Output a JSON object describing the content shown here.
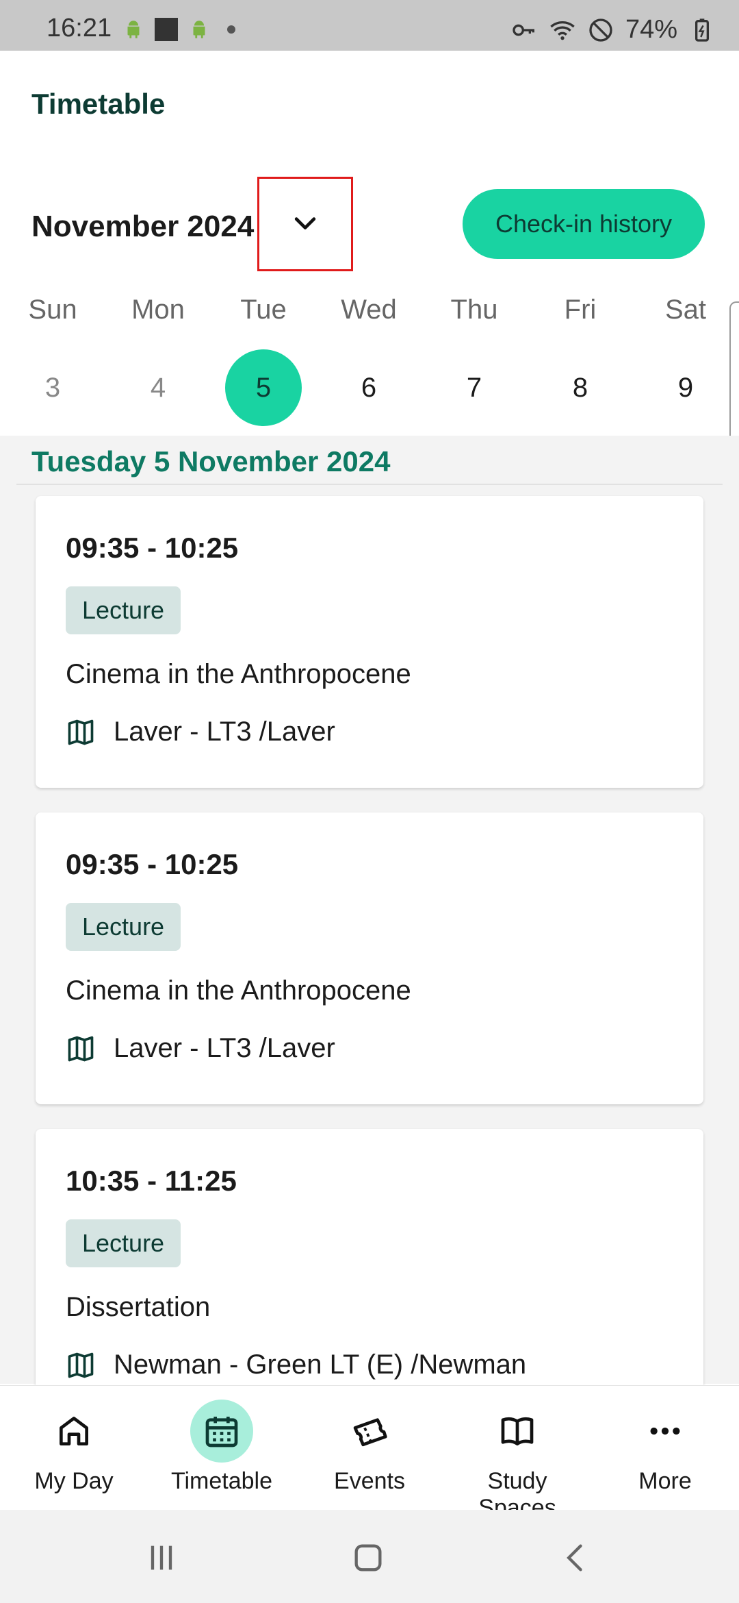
{
  "status_bar": {
    "time": "16:21",
    "battery": "74%"
  },
  "header": {
    "title": "Timetable",
    "month": "November 2024",
    "checkin_label": "Check-in history"
  },
  "week": {
    "days": [
      {
        "name": "Sun",
        "num": "3"
      },
      {
        "name": "Mon",
        "num": "4"
      },
      {
        "name": "Tue",
        "num": "5"
      },
      {
        "name": "Wed",
        "num": "6"
      },
      {
        "name": "Thu",
        "num": "7"
      },
      {
        "name": "Fri",
        "num": "8"
      },
      {
        "name": "Sat",
        "num": "9"
      }
    ],
    "selected": "5"
  },
  "agenda": {
    "date_heading": "Tuesday 5 November 2024",
    "events": [
      {
        "time": "09:35 - 10:25",
        "type": "Lecture",
        "title": "Cinema in the Anthropocene",
        "location": "Laver - LT3 /Laver"
      },
      {
        "time": "09:35 - 10:25",
        "type": "Lecture",
        "title": "Cinema in the Anthropocene",
        "location": "Laver - LT3 /Laver"
      },
      {
        "time": "10:35 - 11:25",
        "type": "Lecture",
        "title": "Dissertation",
        "location": "Newman - Green LT (E) /Newman"
      }
    ]
  },
  "nav": {
    "items": [
      {
        "label": "My Day",
        "icon": "home-icon"
      },
      {
        "label": "Timetable",
        "icon": "calendar-icon",
        "active": true
      },
      {
        "label": "Events",
        "icon": "ticket-icon"
      },
      {
        "label": "Study Spaces",
        "icon": "book-icon"
      },
      {
        "label": "More",
        "icon": "more-icon"
      }
    ]
  },
  "colors": {
    "accent": "#19d3a2",
    "date_heading": "#0e7a63",
    "title_dark": "#0d3b33"
  }
}
